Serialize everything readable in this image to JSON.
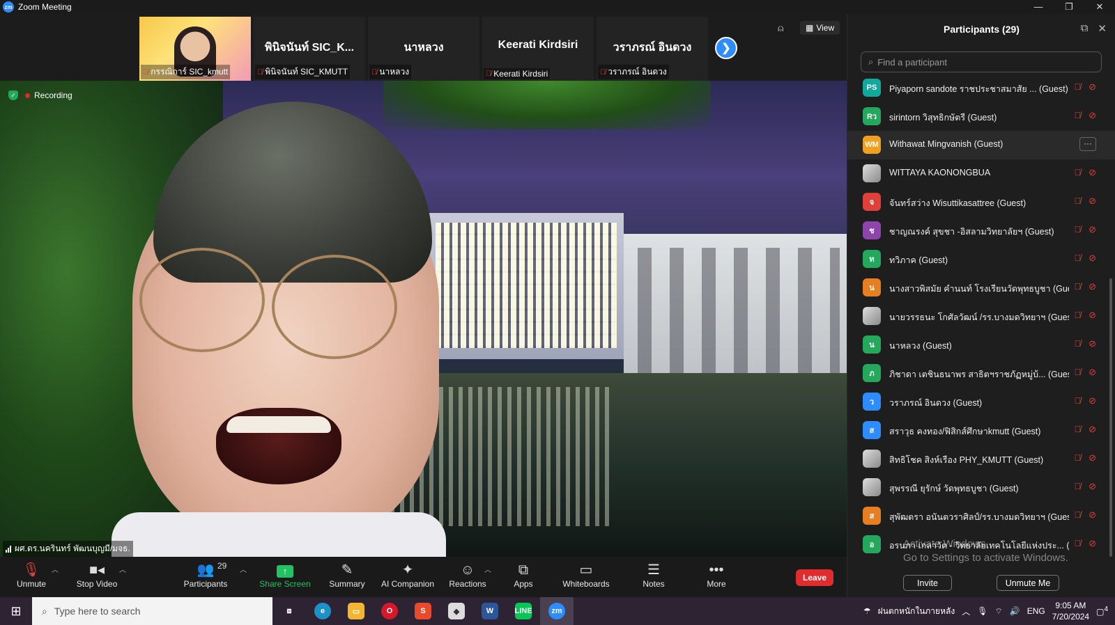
{
  "window": {
    "title": "Zoom Meeting",
    "controls": [
      "—",
      "❐",
      "✕"
    ]
  },
  "top_strip": {
    "tiles": [
      {
        "name": "",
        "label": "กรรณิการ์ SIC_kmutt",
        "photo": true
      },
      {
        "name": "พินิจนันท์ SIC_K...",
        "label": "พินิจนันท์ SIC_KMUTT"
      },
      {
        "name": "นาหลวง",
        "label": "นาหลวง"
      },
      {
        "name": "Keerati Kirdsiri",
        "label": "Keerati Kirdsiri"
      },
      {
        "name": "วราภรณ์ อินดวง",
        "label": "วราภรณ์ อินดวง"
      }
    ],
    "next_icon": "chevron-right-icon",
    "view_label": "View"
  },
  "video": {
    "recording_label": "Recording",
    "speaker_name": "ผศ.ดร.นครินทร์ พัฒนบุญมี/มจธ."
  },
  "toolbar": {
    "unmute": "Unmute",
    "stop_video": "Stop Video",
    "participants": "Participants",
    "participants_count": "29",
    "share_screen": "Share Screen",
    "summary": "Summary",
    "ai_companion": "AI Companion",
    "reactions": "Reactions",
    "apps": "Apps",
    "whiteboards": "Whiteboards",
    "notes": "Notes",
    "more": "More",
    "leave": "Leave"
  },
  "participants_panel": {
    "title": "Participants (29)",
    "search_placeholder": "Find a participant",
    "items": [
      {
        "initials": "PS",
        "color": "#13a89e",
        "name": "Piyaporn sandote  ราชประชาสมาสัย ... (Guest)"
      },
      {
        "initials": "Rว",
        "color": "#23a85c",
        "name": "sirintorn วิสุทธิกษัตรี (Guest)"
      },
      {
        "initials": "WM",
        "color": "#f0a020",
        "name": "Withawat Mingvanish (Guest)",
        "hover": true
      },
      {
        "initials": "",
        "color": "#888888",
        "name": "WITTAYA KAONONGBUA",
        "pic": true
      },
      {
        "initials": "จ",
        "color": "#e0403a",
        "name": "จันทร์สว่าง Wisuttikasattree (Guest)"
      },
      {
        "initials": "ช",
        "color": "#8e44ad",
        "name": "ชาญณรงค์ สุขชา -อิสลามวิทยาลัยฯ (Guest)"
      },
      {
        "initials": "ท",
        "color": "#23a85c",
        "name": "ทวิภาค (Guest)"
      },
      {
        "initials": "น",
        "color": "#e67e22",
        "name": "นางสาวพิสมัย คำนนท์ โรงเรียนวัดพุทธบูชา (Guest)"
      },
      {
        "initials": "",
        "color": "#888888",
        "name": "นายวรรธนะ โกศัลวัฒน์ /รร.บางมดวิทยาฯ (Guest)",
        "pic": true
      },
      {
        "initials": "น",
        "color": "#23a85c",
        "name": "นาหลวง (Guest)"
      },
      {
        "initials": "ภ",
        "color": "#23a85c",
        "name": "ภิชาดา เตชินธนาพร สาธิตฯราชภัฏหมู่บ้... (Guest)"
      },
      {
        "initials": "ว",
        "color": "#2d8cff",
        "name": "วราภรณ์ อินดวง (Guest)"
      },
      {
        "initials": "ส",
        "color": "#2d8cff",
        "name": "สราวุธ คงทอง/ฟิสิกส์ศึกษาkmutt (Guest)"
      },
      {
        "initials": "",
        "color": "#cccccc",
        "name": "สิทธิโชค สิงห์เรือง PHY_KMUTT (Guest)",
        "pic": true
      },
      {
        "initials": "",
        "color": "#888888",
        "name": "สุพรรณี ยุรักษ์ วัดพุทธบูชา (Guest)",
        "pic": true
      },
      {
        "initials": "ส",
        "color": "#e67e22",
        "name": "สุพัฒตรา อนันตวราศิลป์/รร.บางมดวิทยาฯ (Guest)"
      },
      {
        "initials": "อ",
        "color": "#23a85c",
        "name": "อรนภา เกลาวัต - วิทยาลัยเทคโนโลยีแห่งประ... (Guest)"
      }
    ],
    "invite": "Invite",
    "unmute_me": "Unmute Me",
    "watermark_line1": "Activate Windows",
    "watermark_line2": "Go to Settings to activate Windows."
  },
  "taskbar": {
    "search_placeholder": "Type here to search",
    "weather": "ฝนตกหนักในภายหลัง",
    "language": "ENG",
    "time": "9:05 AM",
    "date": "7/20/2024",
    "notifications": "4"
  }
}
